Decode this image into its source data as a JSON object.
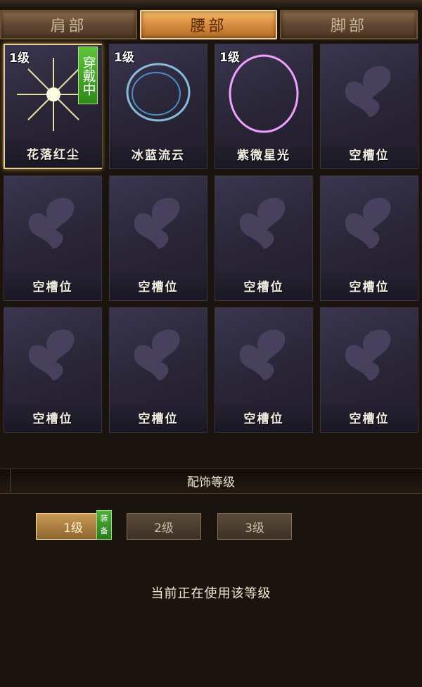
{
  "tabs": [
    {
      "label": "肩部",
      "active": false
    },
    {
      "label": "腰部",
      "active": true
    },
    {
      "label": "脚部",
      "active": false
    }
  ],
  "slots": [
    {
      "name": "花落红尘",
      "level": "1级",
      "wearing": "穿戴中",
      "selected": true
    },
    {
      "name": "冰蓝流云",
      "level": "1级"
    },
    {
      "name": "紫微星光",
      "level": "1级"
    },
    {
      "name": "空槽位"
    },
    {
      "name": "空槽位"
    },
    {
      "name": "空槽位"
    },
    {
      "name": "空槽位"
    },
    {
      "name": "空槽位"
    },
    {
      "name": "空槽位"
    },
    {
      "name": "空槽位"
    },
    {
      "name": "空槽位"
    },
    {
      "name": "空槽位"
    }
  ],
  "level_panel": {
    "title": "配饰等级",
    "levels": [
      {
        "label": "1级",
        "active": true
      },
      {
        "label": "2级",
        "active": false
      },
      {
        "label": "3级",
        "active": false
      }
    ],
    "equip_badge": [
      "装",
      "备"
    ],
    "status": "当前正在使用该等级"
  },
  "colors": {
    "tab_active": "#d48a3c",
    "tab_inactive": "#5e4530",
    "wearing_badge": "#3fa82a",
    "slot_bg": "#2a2638"
  },
  "icons": {
    "empty_slot": "butterfly-icon"
  }
}
